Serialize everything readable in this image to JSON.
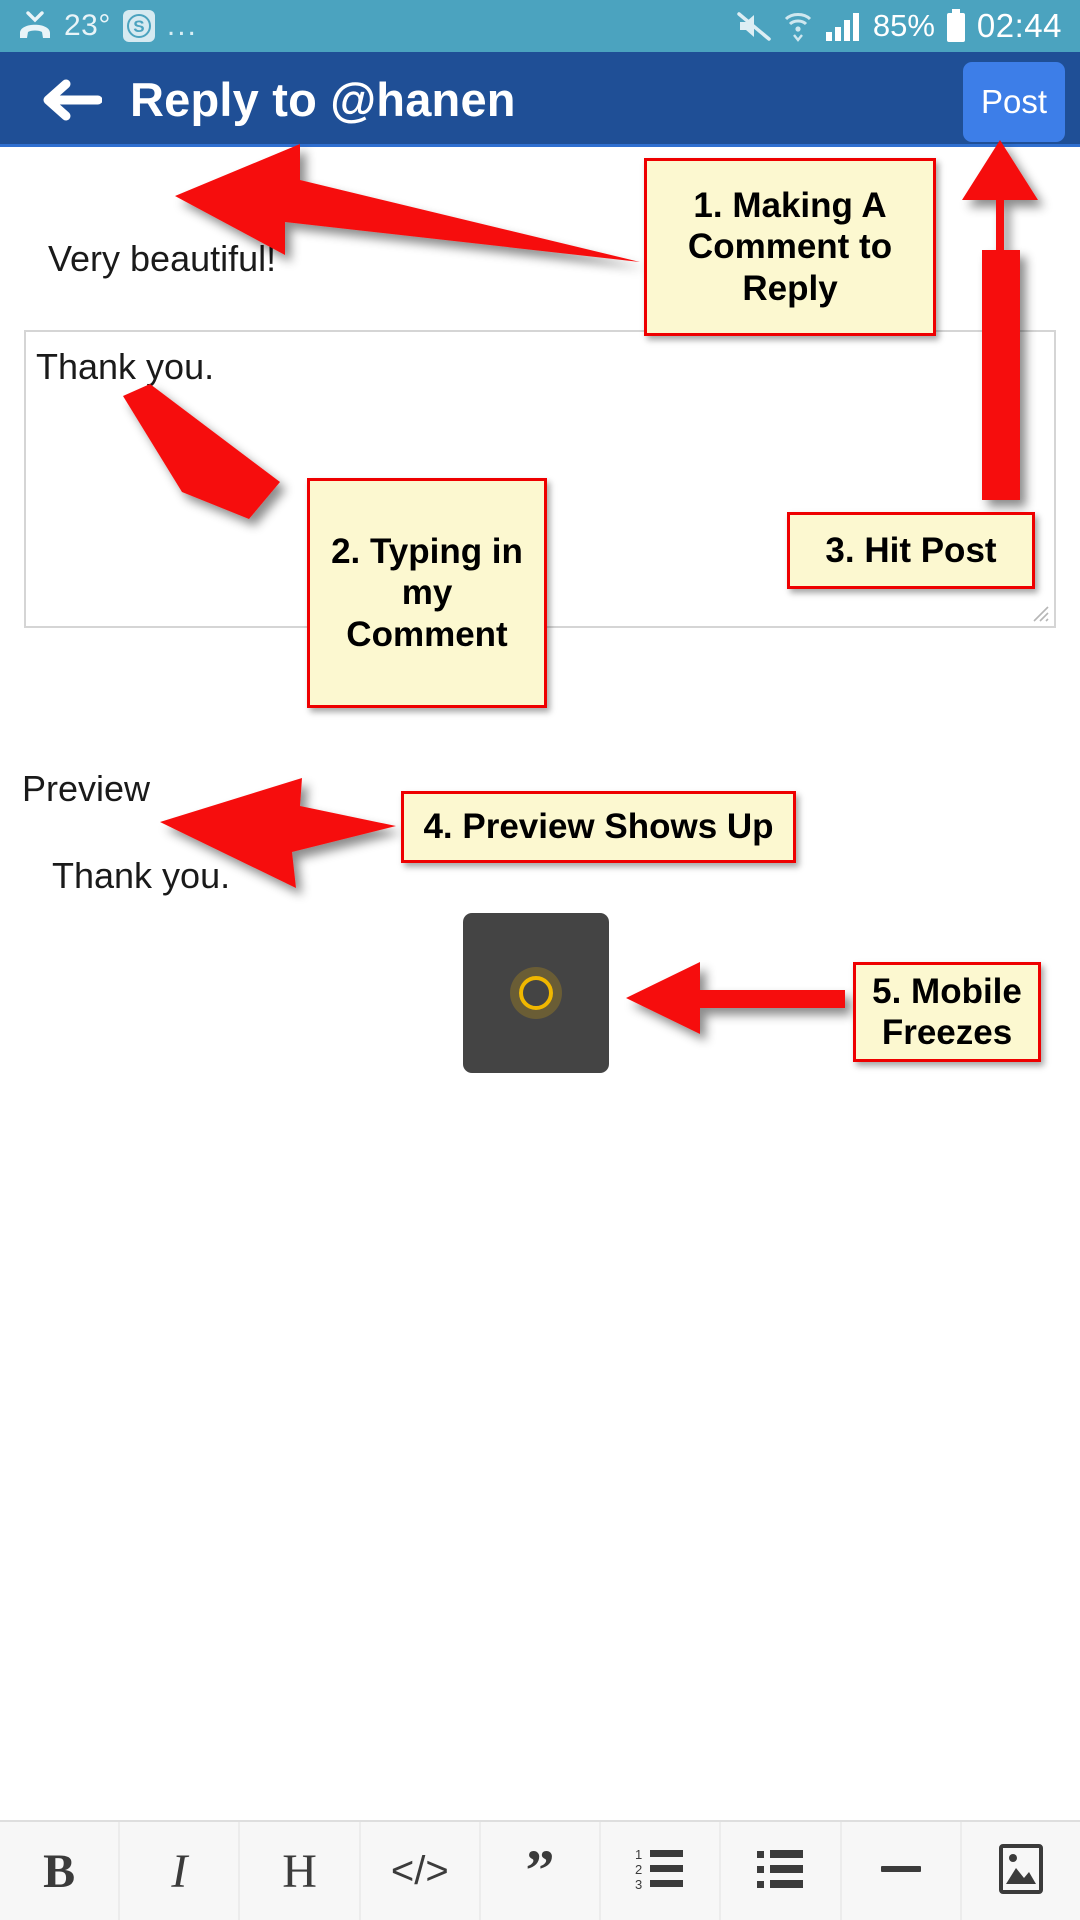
{
  "status_bar": {
    "missed_call_icon": "missed-call-icon",
    "temperature": "23°",
    "skype_badge": "S",
    "overflow": "...",
    "mute_icon": "mute-icon",
    "wifi_icon": "wifi-icon",
    "signal_icon": "signal-bars-icon",
    "battery_percent": "85%",
    "battery_icon": "battery-icon",
    "time": "02:44",
    "background_color": "#4ba3bf"
  },
  "app_bar": {
    "back_label": "back-arrow",
    "title": "Reply to @hanen",
    "post_label": "Post",
    "background_color": "#1f4f96",
    "post_color": "#3d7ee8"
  },
  "content": {
    "quoted_comment": "Very beautiful!",
    "editor_value": "Thank you.",
    "editor_placeholder": "",
    "preview_label": "Preview",
    "preview_text": "Thank you.",
    "spinner": {
      "name": "loading-spinner",
      "box_color": "#444444",
      "ring_color": "#f0b700"
    }
  },
  "toolbar": {
    "items": [
      {
        "name": "bold-icon",
        "glyph": "B"
      },
      {
        "name": "italic-icon",
        "glyph": "I"
      },
      {
        "name": "heading-icon",
        "glyph": "H"
      },
      {
        "name": "code-icon",
        "glyph": "</>"
      },
      {
        "name": "quote-icon",
        "glyph": "”"
      },
      {
        "name": "ordered-list-icon",
        "glyph": ""
      },
      {
        "name": "bullet-list-icon",
        "glyph": ""
      },
      {
        "name": "horizontal-rule-icon",
        "glyph": ""
      },
      {
        "name": "image-icon",
        "glyph": ""
      }
    ]
  },
  "annotations": {
    "accent_color": "#ee0000",
    "note_color": "#fcf8d0",
    "callouts": [
      {
        "id": 1,
        "text": "1.  Making A Comment to Reply"
      },
      {
        "id": 2,
        "text": "2.  Typing in my Comment"
      },
      {
        "id": 3,
        "text": "3.  Hit Post"
      },
      {
        "id": 4,
        "text": "4.  Preview Shows Up"
      },
      {
        "id": 5,
        "text": "5.  Mobile Freezes"
      }
    ]
  }
}
